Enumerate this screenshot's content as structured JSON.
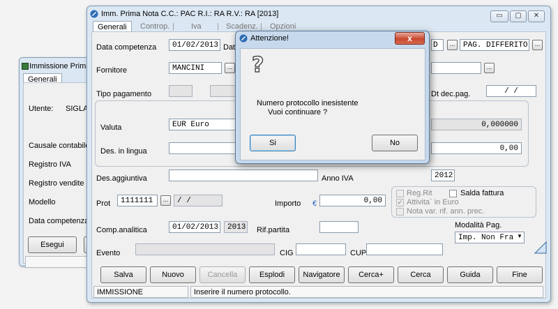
{
  "back_window": {
    "title": "Immissione Prima",
    "tab": "Generali",
    "utente_label": "Utente:",
    "utente_value": "SIGLA",
    "labels": [
      "Causale contabile",
      "Registro IVA",
      "Registro vendite",
      "Modello",
      "Data competenza"
    ],
    "esegui_label": "Esegui"
  },
  "main_window": {
    "title": "Imm. Prima Nota C.C.: PAC  R.I.: RA  R.V.: RA  [2013]",
    "tabs": [
      "Generali",
      "Controp.",
      "Iva",
      "Scadenz.",
      "Opzioni"
    ],
    "caption_buttons": {
      "minimize": "▭",
      "maximize": "▢",
      "close": "✕"
    },
    "fields": {
      "data_competenza_label": "Data competenza",
      "data_competenza_value": "01/02/2013",
      "data_doc_label": "Dat",
      "doc_code_value": "D",
      "pag_value": "PAG. DIFFERITO",
      "fornitore_label": "Fornitore",
      "fornitore_value": "MANCINI",
      "tipo_pagamento_label": "Tipo pagamento",
      "dt_dec_pag_label": "Dt dec.pag.",
      "dt_dec_pag_value": " /  /",
      "valuta_label": "Valuta",
      "valuta_value": "EUR Euro",
      "cambio_value": "0,000000",
      "des_lingua_label": "Des. in lingua",
      "importo_valuta_value": "0,00",
      "des_aggiuntiva_label": "Des.aggiuntiva",
      "anno_iva_label": "Anno IVA",
      "anno_iva_value": "2012",
      "prot_label": "Prot",
      "prot_value": "1111111",
      "prot_date_value": " /  /",
      "importo_label": "Importo",
      "euro_symbol": "€",
      "importo_value": "0,00",
      "comp_analitica_label": "Comp.analitica",
      "comp_analitica_value": "01/02/2013",
      "comp_analitica_year": "2013",
      "rif_partita_label": "Rif.partita",
      "evento_label": "Evento",
      "cig_label": "CIG",
      "cup_label": "CUP",
      "modalita_pag_label": "Modalità Pag.",
      "modalita_pag_value": "Imp. Non Fra"
    },
    "checkboxes": {
      "reg_rit": "Reg.Rit",
      "salda_fattura": "Salda fattura",
      "attivita_euro": "Attivita` in Euro",
      "nota_var": "Nota var. rif. ann. prec."
    },
    "buttons": {
      "salva": "Salva",
      "nuovo": "Nuovo",
      "cancella": "Cancella",
      "esplodi": "Esplodi",
      "navigatore": "Navigatore",
      "cerca_plus": "Cerca+",
      "cerca": "Cerca",
      "guida": "Guida",
      "fine": "Fine"
    },
    "status": {
      "mode": "IMMISSIONE",
      "message": "Inserire il numero protocollo."
    }
  },
  "dialog": {
    "title": "Attenzione!",
    "icon": "question-icon",
    "icon_glyph": "?",
    "close_glyph": "x",
    "message_line1": "Numero protocollo inesistente",
    "message_line2": "Vuoi continuare ?",
    "yes_label": "Si",
    "no_label": "No"
  }
}
